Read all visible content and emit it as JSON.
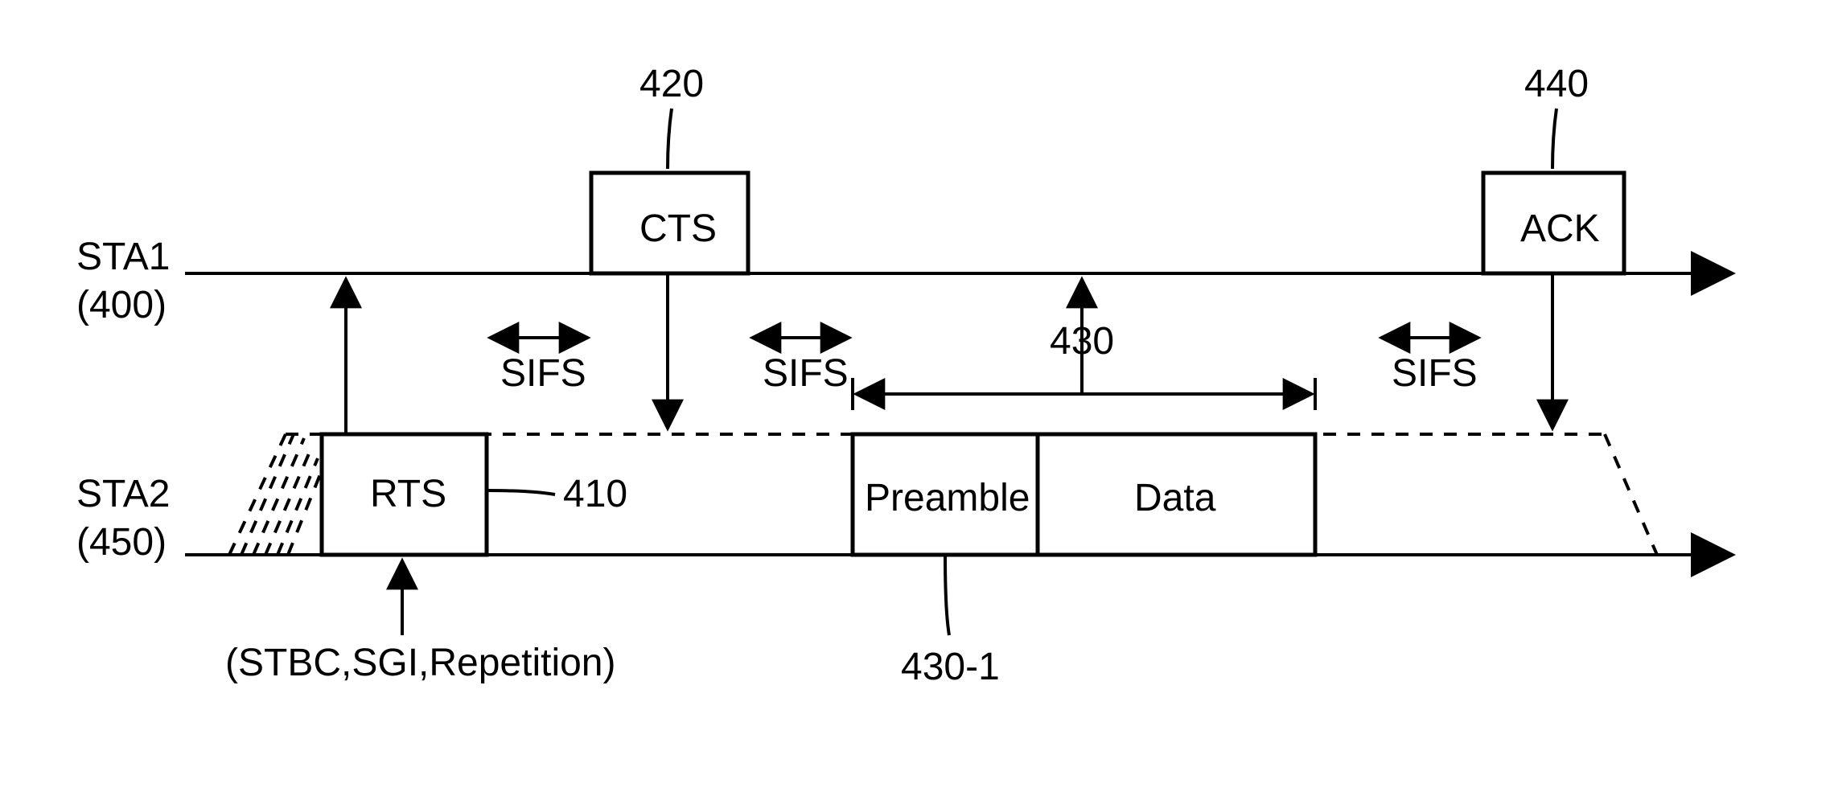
{
  "sta1": {
    "name": "STA1",
    "id": "(400)"
  },
  "sta2": {
    "name": "STA2",
    "id": "(450)"
  },
  "rts": {
    "label": "RTS",
    "ref": "410",
    "note": "(STBC,SGI,Repetition)"
  },
  "cts": {
    "label": "CTS",
    "ref": "420"
  },
  "data": {
    "preamble": "Preamble",
    "data": "Data",
    "ref": "430",
    "preamble_ref": "430-1"
  },
  "ack": {
    "label": "ACK",
    "ref": "440"
  },
  "sifs": {
    "a": "SIFS",
    "b": "SIFS",
    "c": "SIFS"
  }
}
